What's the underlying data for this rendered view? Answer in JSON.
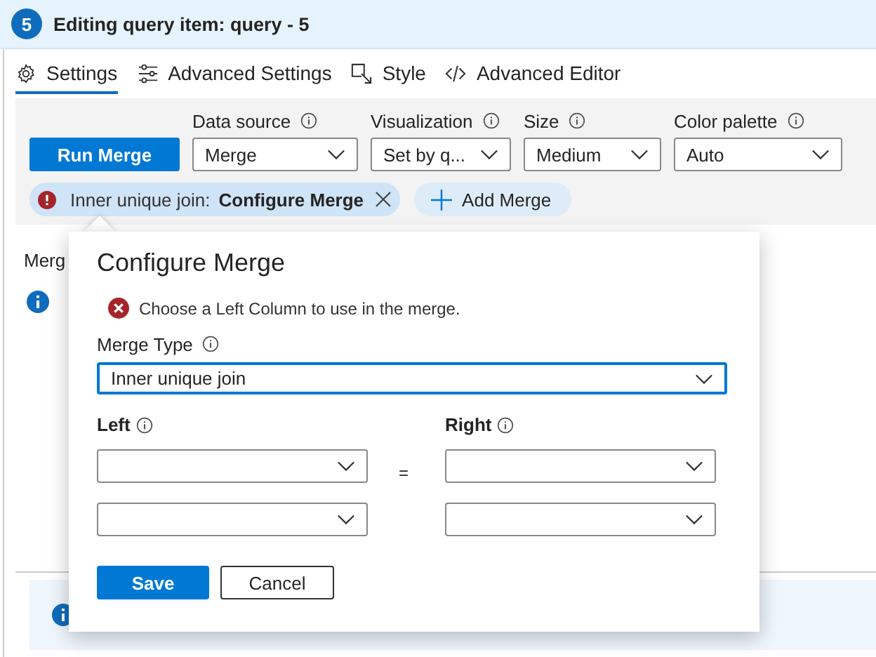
{
  "header": {
    "badge": "5",
    "title": "Editing query item: query - 5"
  },
  "tabs": [
    {
      "label": "Settings",
      "selected": true
    },
    {
      "label": "Advanced Settings",
      "selected": false
    },
    {
      "label": "Style",
      "selected": false
    },
    {
      "label": "Advanced Editor",
      "selected": false
    }
  ],
  "run_button": "Run Merge",
  "dropdowns": [
    {
      "label": "Data source",
      "value": "Merge"
    },
    {
      "label": "Visualization",
      "value": "Set by q..."
    },
    {
      "label": "Size",
      "value": "Medium"
    },
    {
      "label": "Color palette",
      "value": "Auto"
    }
  ],
  "merge_chip": {
    "prefix": "Inner unique join:",
    "action": "Configure Merge"
  },
  "add_merge": "Add Merge",
  "behind": {
    "section_label": "Merg"
  },
  "dialog": {
    "title": "Configure Merge",
    "error": "Choose a Left Column to use in the merge.",
    "merge_type": {
      "label": "Merge Type",
      "value": "Inner unique join"
    },
    "left_label": "Left",
    "right_label": "Right",
    "equals": "=",
    "column_pairs": [
      {
        "kind": "joined"
      },
      {
        "kind": "plain"
      }
    ],
    "buttons": {
      "save": "Save",
      "cancel": "Cancel"
    }
  }
}
